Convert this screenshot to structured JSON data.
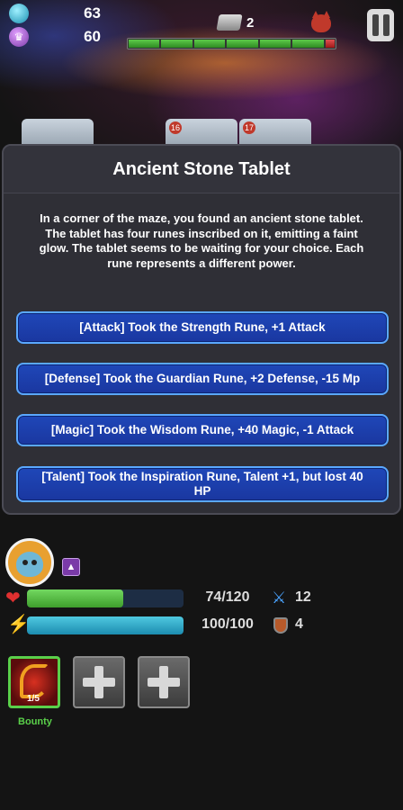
{
  "hud": {
    "gems": "63",
    "coins": "60",
    "keys": "2",
    "gem_icon": "gem-icon",
    "coin_icon": "coin-icon"
  },
  "cards": {
    "badges": [
      "16",
      "17"
    ]
  },
  "modal": {
    "title": "Ancient Stone Tablet",
    "description": "In a corner of the maze, you found an ancient stone tablet. The tablet has four runes inscribed on it, emitting a faint glow. The tablet seems to be waiting for your choice. Each rune represents a different power.",
    "choices": [
      "[Attack] Took the Strength Rune, +1 Attack",
      "[Defense] Took the Guardian Rune, +2 Defense, -15 Mp",
      "[Magic] Took the Wisdom Rune, +40 Magic, -1 Attack",
      "[Talent] Took the Inspiration Rune, Talent +1, but lost 40 HP"
    ]
  },
  "player": {
    "hp": {
      "text": "74/120",
      "current": 74,
      "max": 120
    },
    "mp": {
      "text": "100/100",
      "current": 100,
      "max": 100
    },
    "attack": "12",
    "defense": "4",
    "rank_symbol": "▲"
  },
  "skills": {
    "active": {
      "count": "1/5",
      "label": "Bounty"
    }
  },
  "colors": {
    "choice_button": "#1f47b8",
    "choice_border": "#5aa8ff",
    "hp_bar": "#5ecb4a",
    "mp_bar": "#35b0d0",
    "skill_label": "#5ad04a"
  }
}
